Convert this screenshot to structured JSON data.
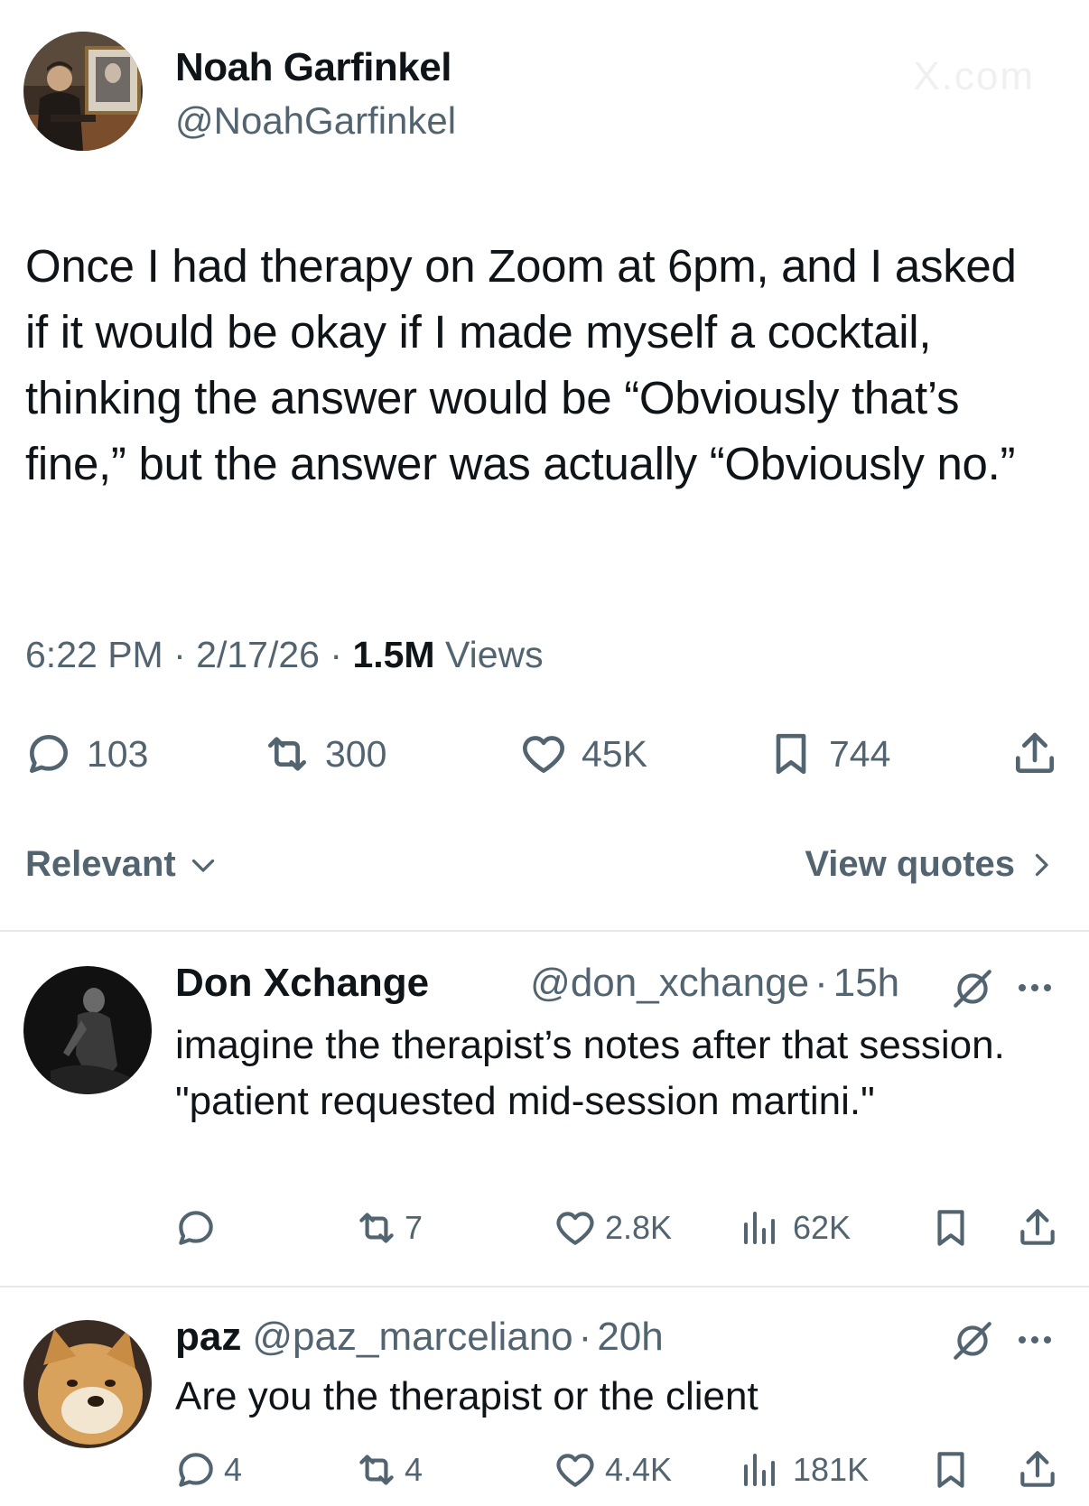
{
  "watermark": "X.com",
  "tweet": {
    "author_name": "Noah Garfinkel",
    "author_handle": "@NoahGarfinkel",
    "text": "Once I had therapy on Zoom at 6pm, and I asked if it would be okay if I made myself a cocktail, thinking the answer would be “Obviously that’s fine,” but the answer was actually “Obviously no.”",
    "time": "6:22 PM",
    "sep1": "·",
    "date": "2/17/26",
    "sep2": "·",
    "views_count": "1.5M",
    "views_label": "Views",
    "replies": "103",
    "reposts": "300",
    "likes": "45K",
    "bookmarks": "744"
  },
  "sort": {
    "label": "Relevant"
  },
  "quotes": {
    "label": "View quotes"
  },
  "replies": [
    {
      "name": "Don Xchange",
      "handle": "@don_xchange",
      "dot": "·",
      "time": "15h",
      "text": "imagine the therapist’s notes after that session. \"patient requested mid-session martini.\"",
      "replies": "",
      "reposts": "7",
      "likes": "2.8K",
      "views": "62K"
    },
    {
      "name": "paz",
      "handle": "@paz_marceliano",
      "dot": "·",
      "time": "20h",
      "text": "Are you the therapist or the client",
      "replies": "4",
      "reposts": "4",
      "likes": "4.4K",
      "views": "181K"
    }
  ],
  "colors": {
    "text": "#0f1419",
    "secondary": "#536471",
    "divider": "#e6e9eb"
  },
  "icons": [
    "reply-icon",
    "repost-icon",
    "like-icon",
    "bookmark-icon",
    "share-icon",
    "views-icon",
    "grok-icon",
    "more-icon",
    "chevron-down-icon",
    "chevron-right-icon"
  ]
}
